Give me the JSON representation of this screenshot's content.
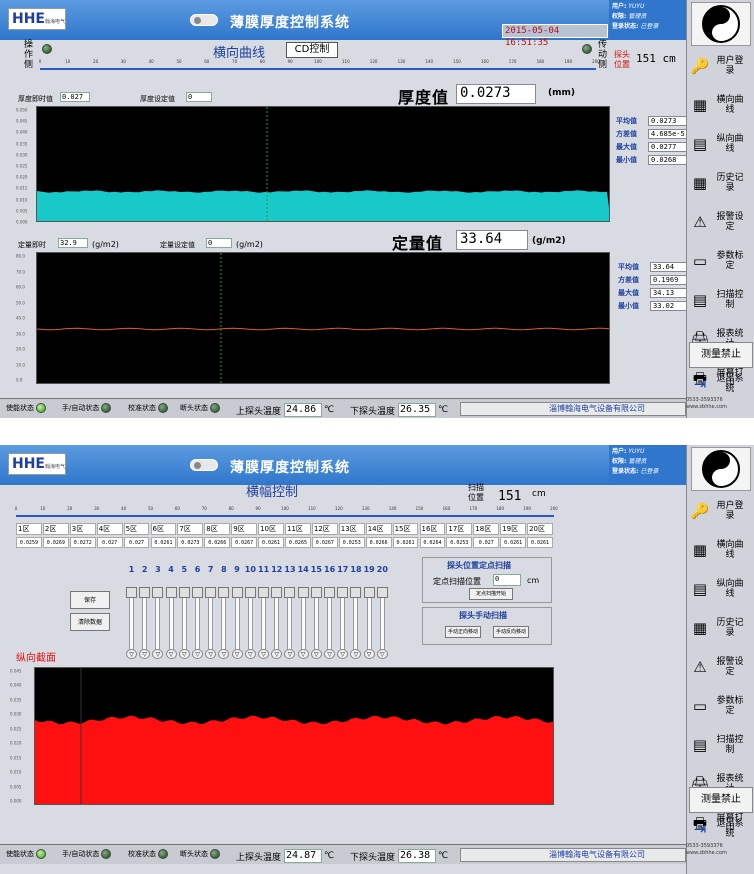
{
  "colors": {
    "title_bg": "#2f76cc",
    "thickness_fill": "#17c9c9",
    "red_fill": "#ff1010",
    "chart_bg": "#000000",
    "accent_text": "#1e3f9e"
  },
  "panel1": {
    "logo": "HHE",
    "logo_sub": "翰海电气",
    "title": "薄膜厚度控制系统",
    "datetime": "2015-05-04 16:51:35",
    "user": {
      "user_label": "用户:",
      "user_value": "YUYU",
      "perm_label": "权限:",
      "perm_value": "管理员",
      "login_label": "登录状态:",
      "login_value": "已登录"
    },
    "curve_title": "横向曲线",
    "cd_button": "CD控制",
    "op_side": "操作侧",
    "drive_side": "传动侧",
    "probe_pos_label": "探头位置",
    "probe_pos_value": "151 cm",
    "thickness_instant_label": "厚度即时值",
    "thickness_instant": "0.027",
    "thickness_set_label": "厚度设定值",
    "thickness_set": "0",
    "thickness_title": "厚度值",
    "thickness_value": "0.0273",
    "thickness_unit": "(mm)",
    "thickness_stats": [
      {
        "label": "平均值",
        "value": "0.0273"
      },
      {
        "label": "方差值",
        "value": "4.685e-5"
      },
      {
        "label": "最大值",
        "value": "0.0277"
      },
      {
        "label": "最小值",
        "value": "0.0268"
      }
    ],
    "basis_instant_label": "定量即时",
    "basis_instant": "32.9",
    "basis_unit_small": "(g/m2)",
    "basis_set_label": "定量设定值",
    "basis_set": "0",
    "basis_title": "定量值",
    "basis_value": "33.64",
    "basis_unit": "(g/m2)",
    "basis_stats": [
      {
        "label": "平均值",
        "value": "33.64"
      },
      {
        "label": "方差值",
        "value": "0.1969"
      },
      {
        "label": "最大值",
        "value": "34.13"
      },
      {
        "label": "最小值",
        "value": "33.02"
      }
    ],
    "ruler_ticks": [
      "0",
      "10",
      "20",
      "30",
      "40",
      "50",
      "60",
      "70",
      "80",
      "90",
      "100",
      "110",
      "120",
      "130",
      "140",
      "150",
      "160",
      "170",
      "180",
      "190",
      "200"
    ],
    "thickness_ylabels": [
      "0.050",
      "0.045",
      "0.040",
      "0.035",
      "0.030",
      "0.025",
      "0.020",
      "0.015",
      "0.010",
      "0.005",
      "0.000"
    ],
    "basis_ylabels": [
      "80.0",
      "70.0",
      "60.0",
      "50.0",
      "40.0",
      "30.0",
      "20.0",
      "10.0",
      "0.0"
    ]
  },
  "panel2": {
    "logo": "HHE",
    "logo_sub": "翰海电气",
    "title": "薄膜厚度控制系统",
    "user": {
      "user_label": "用户:",
      "user_value": "YUYU",
      "perm_label": "权限:",
      "perm_value": "管理员",
      "login_label": "登录状态:",
      "login_value": "已登录"
    },
    "width_title": "横幅控制",
    "scan_pos_label": "扫描位置",
    "scan_pos_value": "151",
    "scan_pos_unit": "cm",
    "zones": [
      "1区",
      "2区",
      "3区",
      "4区",
      "5区",
      "6区",
      "7区",
      "8区",
      "9区",
      "10区",
      "11区",
      "12区",
      "13区",
      "14区",
      "15区",
      "16区",
      "17区",
      "18区",
      "19区",
      "20区"
    ],
    "zone_values": [
      "0.0259",
      "0.0269",
      "0.0272",
      "0.027",
      "0.027",
      "0.0261",
      "0.0273",
      "0.0266",
      "0.0267",
      "0.0261",
      "0.0265",
      "0.0267",
      "0.0253",
      "0.0266",
      "0.0261",
      "0.0264",
      "0.0253",
      "0.027",
      "0.0261",
      "0.0261"
    ],
    "slider_numbers": [
      "1",
      "2",
      "3",
      "4",
      "5",
      "6",
      "7",
      "8",
      "9",
      "10",
      "11",
      "12",
      "13",
      "14",
      "15",
      "16",
      "17",
      "18",
      "19",
      "20"
    ],
    "btn_save": "保存",
    "btn_clear": "清除数据",
    "fixed_scan_title": "探头位置定点扫描",
    "fixed_scan_label": "定点扫描位置",
    "fixed_scan_value": "0",
    "fixed_scan_unit": "cm",
    "fixed_scan_btn": "定点扫描开始",
    "manual_title": "探头手动扫描",
    "manual_left": "手动正向移动",
    "manual_right": "手动反向移动",
    "profile_title": "纵向截面",
    "profile_ylabels": [
      "0.045",
      "0.040",
      "0.035",
      "0.030",
      "0.025",
      "0.020",
      "0.015",
      "0.010",
      "0.005",
      "0.000"
    ]
  },
  "side": {
    "items": [
      "用户登录",
      "横向曲线",
      "纵向曲线",
      "历史记录",
      "报警设定",
      "参数标定",
      "扫描控制",
      "报表统计",
      "屏幕打印"
    ],
    "disable": "测量禁止",
    "exit": "退出系统"
  },
  "status": {
    "s1": "使能状态",
    "s2": "手/自动状态",
    "s3": "校准状态",
    "s4": "断头状态",
    "upper_temp_label": "上探头温度",
    "upper_temp": "24.86",
    "lower_temp_label": "下探头温度",
    "lower_temp": "26.35",
    "upper_temp2": "24.87",
    "lower_temp2": "26.38",
    "deg": "℃",
    "company": "淄博翰海电气设备有限公司",
    "phone": "0533-3593376",
    "web": "www.zbhhe.com"
  }
}
